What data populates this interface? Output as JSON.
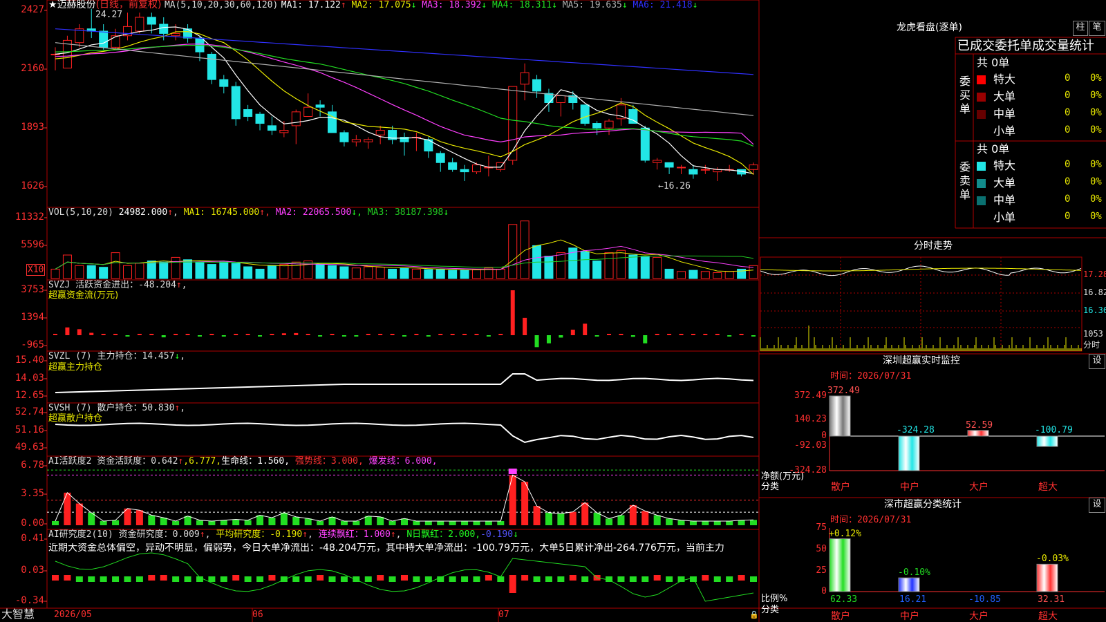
{
  "app": {
    "name": "大智慧"
  },
  "stock": {
    "star": "★",
    "name": "迈赫股份",
    "mode": "(日线，前复权)"
  },
  "colors": {
    "up": "#ff2020",
    "down": "#22e6e6",
    "ma1": "#ffffff",
    "ma2": "#e8e800",
    "ma3": "#ff40ff",
    "ma4": "#22dd22",
    "ma5": "#b0b0b0",
    "ma6": "#3030ff",
    "grid": "#b00000",
    "axis": "#ff3030",
    "vol_ma3": "#22cc22"
  },
  "main": {
    "ma_header": "MA(5,10,20,30,60,120)",
    "ma_items": [
      {
        "name": "MA1:",
        "value": "17.122",
        "arrow": "↑",
        "color": "#ffffff"
      },
      {
        "name": "MA2:",
        "value": "17.075",
        "arrow": "↓",
        "color": "#e8e800"
      },
      {
        "name": "MA3:",
        "value": "18.392",
        "arrow": "↓",
        "color": "#ff40ff"
      },
      {
        "name": "MA4:",
        "value": "18.311",
        "arrow": "↓",
        "color": "#22dd22"
      },
      {
        "name": "MA5:",
        "value": "19.635",
        "arrow": "↓",
        "color": "#b0b0b0"
      },
      {
        "name": "MA6:",
        "value": "21.418",
        "arrow": "↓",
        "color": "#3030ff"
      }
    ],
    "y_labels": [
      "2427",
      "2160",
      "1893",
      "1626"
    ],
    "high_label": "24.27",
    "low_label": "←16.26"
  },
  "vol": {
    "header": "VOL(5,10,20)",
    "value": "24982.000",
    "value_arrow": "↑",
    "items": [
      {
        "name": "MA1:",
        "value": "16745.000",
        "arrow": "↑",
        "color": "#e8e800"
      },
      {
        "name": "MA2:",
        "value": "22065.500",
        "arrow": "↓",
        "color": "#ff40ff"
      },
      {
        "name": "MA3:",
        "value": "38187.398",
        "arrow": "↓",
        "color": "#22cc22"
      }
    ],
    "y_labels": [
      "11332",
      "5596"
    ],
    "unit": "X10"
  },
  "svzj": {
    "line1": "SVZJ  活跃资金进出：-48.204",
    "arrow": "↑",
    "tail": ",",
    "subtitle": "超赢资金流(万元)",
    "y_labels": [
      "3753",
      "1394",
      "-965"
    ]
  },
  "svzl": {
    "line1": "SVZL (7) 主力持仓：14.457",
    "arrow": "↓",
    "tail": ",",
    "subtitle": "超赢主力持仓",
    "y_labels": [
      "15.40",
      "14.03",
      "12.65"
    ]
  },
  "svsh": {
    "line1": "SVSH (7) 散户持仓：50.830",
    "arrow": "↑",
    "tail": ",",
    "subtitle": "超赢散户持仓",
    "y_labels": [
      "52.74",
      "51.16",
      "49.63"
    ]
  },
  "ai1": {
    "line1": "AI活跃度2 资金活跃度：0.642",
    "arrow1": "↑",
    "v2": ",6.777,",
    "life": "生命线：1.560,",
    "strong": "强势线：3.000,",
    "burst": "爆发线：6.000,",
    "y_labels": [
      "6.78",
      "3.35",
      "0.00"
    ]
  },
  "ai2": {
    "line1": "AI研究度2(10) 资金研究度：0.009",
    "arrow1": "↑",
    "avg": "平均研究度：-0.190",
    "arrow2": "↑",
    "lianxu": "连续飘红：1.000",
    "arrow3": "↑",
    "nday": "N日飘红：2.000,",
    "neg": "-0.190",
    "arrow4": "↓",
    "comment": "近期大资金总体偏空，异动不明显，偏弱势，今日大单净流出：-48.204万元，其中特大单净流出：-100.79万元，大单5日累计净出-264.776万元，当前主力",
    "y_labels": [
      "0.41",
      "0.03",
      "-0.34"
    ]
  },
  "xaxis": {
    "labels": [
      "2026/05",
      "06",
      "07"
    ]
  },
  "lhb": {
    "title": "龙虎看盘(逐单)",
    "btn1": "柱",
    "btn2": "笔",
    "subtitle": "已成交委托单成交量统计",
    "buy": {
      "side": "委买单",
      "total": "共 0单",
      "rows": [
        {
          "label": "特大",
          "count": "0",
          "pct": "0%",
          "color": "#ff0000"
        },
        {
          "label": "大单",
          "count": "0",
          "pct": "0%",
          "color": "#990000"
        },
        {
          "label": "中单",
          "count": "0",
          "pct": "0%",
          "color": "#660000"
        },
        {
          "label": "小单",
          "count": "0",
          "pct": "0%",
          "color": "#000000"
        }
      ]
    },
    "sell": {
      "side": "委卖单",
      "total": "共 0单",
      "rows": [
        {
          "label": "特大",
          "count": "0",
          "pct": "0%",
          "color": "#22e6e6"
        },
        {
          "label": "大单",
          "count": "0",
          "pct": "0%",
          "color": "#128c8c"
        },
        {
          "label": "中单",
          "count": "0",
          "pct": "0%",
          "color": "#0a7070"
        },
        {
          "label": "小单",
          "count": "0",
          "pct": "0%",
          "color": "#000000"
        }
      ]
    }
  },
  "intraday": {
    "title": "分时走势",
    "labels": [
      "17.28",
      "16.82",
      "16.36",
      "1053",
      "分时"
    ]
  },
  "sz_monitor": {
    "title": "深圳超赢实时监控",
    "btn": "设",
    "time": "时间：2026/07/31",
    "y_labels": [
      "372.49",
      "140.23",
      "0",
      "-92.03",
      "-324.28"
    ],
    "ylabel": "净额(万元)",
    "xlabel": "分类",
    "cats": [
      "散户",
      "中户",
      "大户",
      "超大"
    ],
    "values": [
      372.49,
      -324.28,
      52.59,
      -100.79
    ],
    "value_labels": [
      "372.49",
      "-324.28",
      "52.59",
      "-100.79"
    ]
  },
  "sz_class": {
    "title": "深市超赢分类统计",
    "btn": "设",
    "time": "时间：2026/07/31",
    "y_labels": [
      "75",
      "50",
      "25",
      "0"
    ],
    "ylabel": "比例%",
    "xlabel": "分类",
    "cats": [
      "散户",
      "中户",
      "大户",
      "超大"
    ],
    "pct_labels": [
      "+0.12%",
      "-0.10%",
      "",
      "-0.03%"
    ],
    "values": [
      62.33,
      16.21,
      -10.85,
      32.31
    ],
    "value_labels": [
      "62.33",
      "16.21",
      "-10.85",
      "32.31"
    ]
  },
  "chart_data": {
    "type": "candlestick",
    "title": "迈赫股份 (日线，前复权)",
    "ohlc": [
      [
        22.3,
        22.3,
        21.6,
        22.6
      ],
      [
        21.7,
        22.9,
        21.7,
        23.1
      ],
      [
        22.8,
        23.4,
        22.6,
        23.6
      ],
      [
        23.4,
        23.3,
        23.0,
        24.27
      ],
      [
        23.3,
        22.6,
        22.5,
        23.6
      ],
      [
        22.6,
        23.1,
        22.5,
        23.4
      ],
      [
        23.1,
        23.5,
        22.9,
        24.1
      ],
      [
        23.3,
        23.9,
        23.2,
        24.1
      ],
      [
        23.9,
        23.6,
        23.2,
        24.1
      ],
      [
        23.6,
        23.2,
        22.9,
        23.9
      ],
      [
        23.1,
        23.2,
        22.9,
        23.6
      ],
      [
        23.4,
        23.0,
        22.8,
        23.6
      ],
      [
        23.0,
        22.4,
        22.0,
        23.1
      ],
      [
        22.3,
        21.2,
        21.0,
        22.4
      ],
      [
        21.2,
        20.9,
        20.6,
        21.4
      ],
      [
        20.9,
        19.5,
        19.2,
        21.1
      ],
      [
        19.9,
        19.6,
        19.4,
        20.1
      ],
      [
        19.7,
        19.3,
        19.0,
        19.8
      ],
      [
        19.2,
        19.0,
        18.8,
        19.6
      ],
      [
        18.9,
        19.0,
        18.7,
        19.4
      ],
      [
        19.2,
        19.8,
        18.4,
        19.9
      ],
      [
        19.6,
        20.0,
        19.6,
        20.6
      ],
      [
        20.1,
        20.0,
        19.6,
        20.3
      ],
      [
        19.8,
        18.9,
        18.9,
        20.1
      ],
      [
        18.9,
        18.5,
        18.3,
        19.0
      ],
      [
        18.5,
        18.6,
        18.3,
        18.8
      ],
      [
        18.5,
        18.6,
        18.2,
        18.7
      ],
      [
        18.8,
        19.0,
        18.4,
        19.2
      ],
      [
        19.0,
        18.6,
        18.4,
        19.2
      ],
      [
        18.7,
        18.5,
        17.9,
        18.9
      ],
      [
        18.7,
        18.7,
        18.1,
        18.9
      ],
      [
        18.6,
        18.1,
        17.8,
        18.7
      ],
      [
        18.0,
        17.6,
        17.2,
        18.1
      ],
      [
        17.6,
        17.3,
        17.2,
        17.8
      ],
      [
        17.3,
        17.2,
        16.8,
        17.5
      ],
      [
        17.2,
        17.5,
        17.1,
        17.6
      ],
      [
        17.4,
        17.4,
        17.0,
        17.9
      ],
      [
        17.3,
        17.6,
        17.2,
        17.6
      ],
      [
        17.7,
        20.9,
        17.5,
        20.9
      ],
      [
        21.0,
        21.5,
        20.3,
        21.9
      ],
      [
        21.2,
        20.7,
        20.4,
        21.4
      ],
      [
        20.6,
        20.2,
        19.8,
        20.8
      ],
      [
        20.2,
        20.5,
        19.6,
        20.5
      ],
      [
        20.5,
        20.2,
        19.9,
        20.7
      ],
      [
        20.1,
        19.3,
        19.2,
        20.1
      ],
      [
        19.3,
        19.1,
        18.8,
        19.4
      ],
      [
        19.1,
        19.4,
        18.8,
        19.5
      ],
      [
        19.5,
        20.1,
        19.2,
        20.4
      ],
      [
        19.9,
        19.3,
        19.3,
        20.1
      ],
      [
        19.1,
        17.7,
        17.6,
        19.2
      ],
      [
        17.6,
        17.7,
        17.3,
        17.8
      ],
      [
        17.6,
        17.4,
        17.1,
        17.6
      ],
      [
        17.4,
        17.4,
        17.1,
        17.5
      ],
      [
        17.3,
        17.1,
        16.9,
        17.5
      ],
      [
        17.3,
        17.3,
        17.1,
        17.5
      ],
      [
        17.2,
        17.3,
        16.8,
        17.4
      ],
      [
        17.3,
        17.3,
        17.2,
        17.5
      ],
      [
        17.3,
        17.1,
        17.0,
        17.3
      ],
      [
        17.3,
        17.5,
        17.1,
        17.6
      ]
    ],
    "ma_series": [
      {
        "name": "MA1",
        "start": 22.3,
        "end": 17.12
      },
      {
        "name": "MA2",
        "start": 22.1,
        "end": 17.08
      },
      {
        "name": "MA3",
        "start": 22.2,
        "end": 18.39
      },
      {
        "name": "MA4",
        "start": 22.4,
        "end": 18.31
      },
      {
        "name": "MA5",
        "start": 22.8,
        "end": 19.64
      },
      {
        "name": "MA6",
        "start": 23.4,
        "end": 21.42
      }
    ],
    "ylim": [
      15.9,
      24.5
    ],
    "volume": [
      40,
      100,
      55,
      55,
      48,
      110,
      55,
      65,
      75,
      70,
      90,
      80,
      70,
      60,
      70,
      65,
      50,
      40,
      55,
      60,
      70,
      75,
      60,
      55,
      50,
      45,
      50,
      48,
      40,
      45,
      40,
      38,
      38,
      35,
      35,
      38,
      45,
      40,
      230,
      245,
      140,
      95,
      110,
      130,
      115,
      75,
      110,
      120,
      100,
      95,
      90,
      40,
      30,
      35,
      30,
      25,
      30,
      40,
      55
    ],
    "svzj": [
      70,
      650,
      500,
      200,
      40,
      40,
      -40,
      90,
      20,
      -180,
      80,
      60,
      -100,
      20,
      -120,
      40,
      100,
      -60,
      20,
      160,
      180,
      60,
      -60,
      20,
      -60,
      -80,
      40,
      20,
      40,
      -60,
      60,
      -100,
      40,
      40,
      60,
      40,
      -60,
      40,
      3753,
      1450,
      -1000,
      -680,
      -200,
      460,
      960,
      -90,
      60,
      60,
      -140,
      -680,
      40,
      100,
      40,
      60,
      80,
      60,
      -60,
      80,
      -48
    ],
    "ai1": [
      0.5,
      3.9,
      2.6,
      1.5,
      0.5,
      0.6,
      2.0,
      1.8,
      1.2,
      0.9,
      0.5,
      1.1,
      0.6,
      0.5,
      0.6,
      0.7,
      0.6,
      1.2,
      0.9,
      1.5,
      1.0,
      0.8,
      0.5,
      1.0,
      0.5,
      0.5,
      1.1,
      1.0,
      0.5,
      0.8,
      0.5,
      0.5,
      0.5,
      0.5,
      0.5,
      0.5,
      0.5,
      0.5,
      6.0,
      5.2,
      2.3,
      1.5,
      1.4,
      1.6,
      2.7,
      1.5,
      0.8,
      1.2,
      2.4,
      1.7,
      1.2,
      0.8,
      0.6,
      0.5,
      0.5,
      0.5,
      0.5,
      0.6,
      0.642
    ]
  }
}
